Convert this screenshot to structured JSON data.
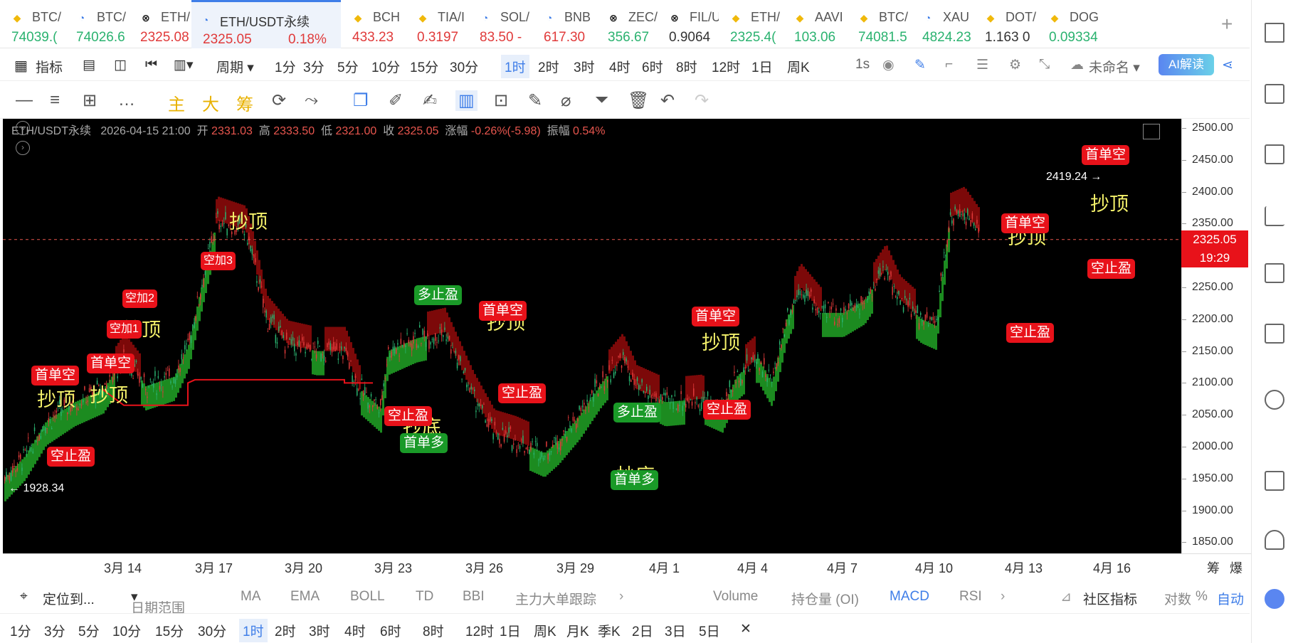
{
  "tabs": [
    {
      "ico": "bn",
      "name": "BTC/",
      "price": "74039.(",
      "color": "#2ab26f"
    },
    {
      "ico": "eth",
      "name": "BTC/",
      "price": "74026.6",
      "color": "#2ab26f"
    },
    {
      "ico": "ok",
      "name": "ETH/",
      "price": "2325.08",
      "color": "#e03a3a"
    },
    {
      "ico": "eth",
      "name": "ETH/USDT永续",
      "price": "2325.05",
      "pct": "0.18%",
      "color": "#e03a3a",
      "active": true
    },
    {
      "ico": "bn",
      "name": "BCH",
      "price": "433.23",
      "color": "#e03a3a"
    },
    {
      "ico": "bn",
      "name": "TIA/I",
      "price": "0.3197",
      "color": "#e03a3a"
    },
    {
      "ico": "eth",
      "name": "SOL/",
      "price": "83.50  -",
      "color": "#e03a3a"
    },
    {
      "ico": "eth",
      "name": "BNB",
      "price": "617.30",
      "color": "#e03a3a"
    },
    {
      "ico": "ok",
      "name": "ZEC/",
      "price": "356.67",
      "color": "#2ab26f"
    },
    {
      "ico": "ok",
      "name": "FIL/U",
      "price": "0.9064",
      "color": "#333"
    },
    {
      "ico": "bn",
      "name": "ETH/",
      "price": "2325.4(",
      "color": "#2ab26f"
    },
    {
      "ico": "bn",
      "name": "AAVI",
      "price": "103.06",
      "color": "#2ab26f"
    },
    {
      "ico": "bn",
      "name": "BTC/",
      "price": "74081.5",
      "color": "#2ab26f"
    },
    {
      "ico": "eth",
      "name": "XAU",
      "price": "4824.23",
      "color": "#2ab26f"
    },
    {
      "ico": "bn",
      "name": "DOT/",
      "price": "1.163  0",
      "color": "#333"
    },
    {
      "ico": "bn",
      "name": "DOG",
      "price": "0.09334",
      "color": "#2ab26f"
    }
  ],
  "toolbar": {
    "indicators": "指标",
    "period": "周期",
    "timeframes": [
      "1分",
      "3分",
      "5分",
      "10分",
      "15分",
      "30分",
      "1时",
      "2时",
      "3时",
      "4时",
      "6时",
      "8时",
      "12时",
      "1日",
      "周K"
    ],
    "interval": "1s",
    "layout_name": "未命名",
    "ai_label": "AI解读"
  },
  "drawtools": {
    "main": "主",
    "big": "大",
    "chip": "筹"
  },
  "info": {
    "symbol": "ETH/USDT永续",
    "datetime": "2026-04-15 21:00",
    "open_l": "开",
    "open": "2331.03",
    "high_l": "高",
    "high": "2333.50",
    "low_l": "低",
    "low": "2321.00",
    "close_l": "收",
    "close": "2325.05",
    "chg_l": "涨幅",
    "chg": "-0.26%(-5.98)",
    "amp_l": "振幅",
    "amp": "0.54%"
  },
  "price_axis": {
    "ticks": [
      "2500.00",
      "2450.00",
      "2400.00",
      "2350.00",
      "2300.00",
      "2250.00",
      "2200.00",
      "2150.00",
      "2100.00",
      "2050.00",
      "2000.00",
      "1950.00",
      "1900.00",
      "1850.00"
    ],
    "current": "2325.05",
    "countdown": "19:29"
  },
  "x_axis": {
    "ticks": [
      "3月 14",
      "3月 17",
      "3月 20",
      "3月 23",
      "3月 26",
      "3月 29",
      "4月 1",
      "4月 4",
      "4月 7",
      "4月 10",
      "4月 13",
      "4月 16"
    ],
    "right1": "筹",
    "right2": "爆"
  },
  "extremes": {
    "high": "2419.24",
    "low": "1928.34"
  },
  "signals": {
    "first_short": "首单空",
    "first_long": "首单多",
    "short_tp": "空止盈",
    "long_tp": "多止盈",
    "add1": "空加1",
    "add2": "空加2",
    "add3": "空加3",
    "top": "抄顶",
    "bottom": "抄底",
    "bottom_partial": "抄底"
  },
  "bottom_bar": {
    "locate": "定位到...",
    "date_range": "日期范围",
    "main_ind": [
      "MA",
      "EMA",
      "BOLL",
      "TD",
      "BBI",
      "主力大单跟踪"
    ],
    "sub_ind": [
      "Volume",
      "持仓量 (OI)",
      "MACD",
      "RSI"
    ],
    "community": "社区指标",
    "log": "对数",
    "pct": "%",
    "auto": "自动"
  },
  "bottom_timeframes": [
    "1分",
    "3分",
    "5分",
    "10分",
    "15分",
    "30分",
    "1时",
    "2时",
    "3时",
    "4时",
    "6时",
    "8时",
    "12时",
    "1日",
    "周K",
    "月K",
    "季K",
    "2日",
    "3日",
    "5日"
  ],
  "colors": {
    "up": "#2ab26f",
    "down": "#e03a3a",
    "accent": "#3f7ee8",
    "signal_red": "#e8121a",
    "signal_green": "#1a9a28",
    "annotation": "#f5f26b"
  },
  "chart_data": {
    "type": "candlestick",
    "ylim": [
      1825,
      2510
    ],
    "current_price": 2325.05,
    "bands": [
      {
        "color": "green",
        "x": [
          3,
          13,
          18
        ],
        "mid": [
          1945,
          1985,
          2015
        ]
      },
      {
        "color": "red",
        "x": [
          54,
          60
        ],
        "mid": [
          2020,
          2000
        ]
      }
    ]
  }
}
